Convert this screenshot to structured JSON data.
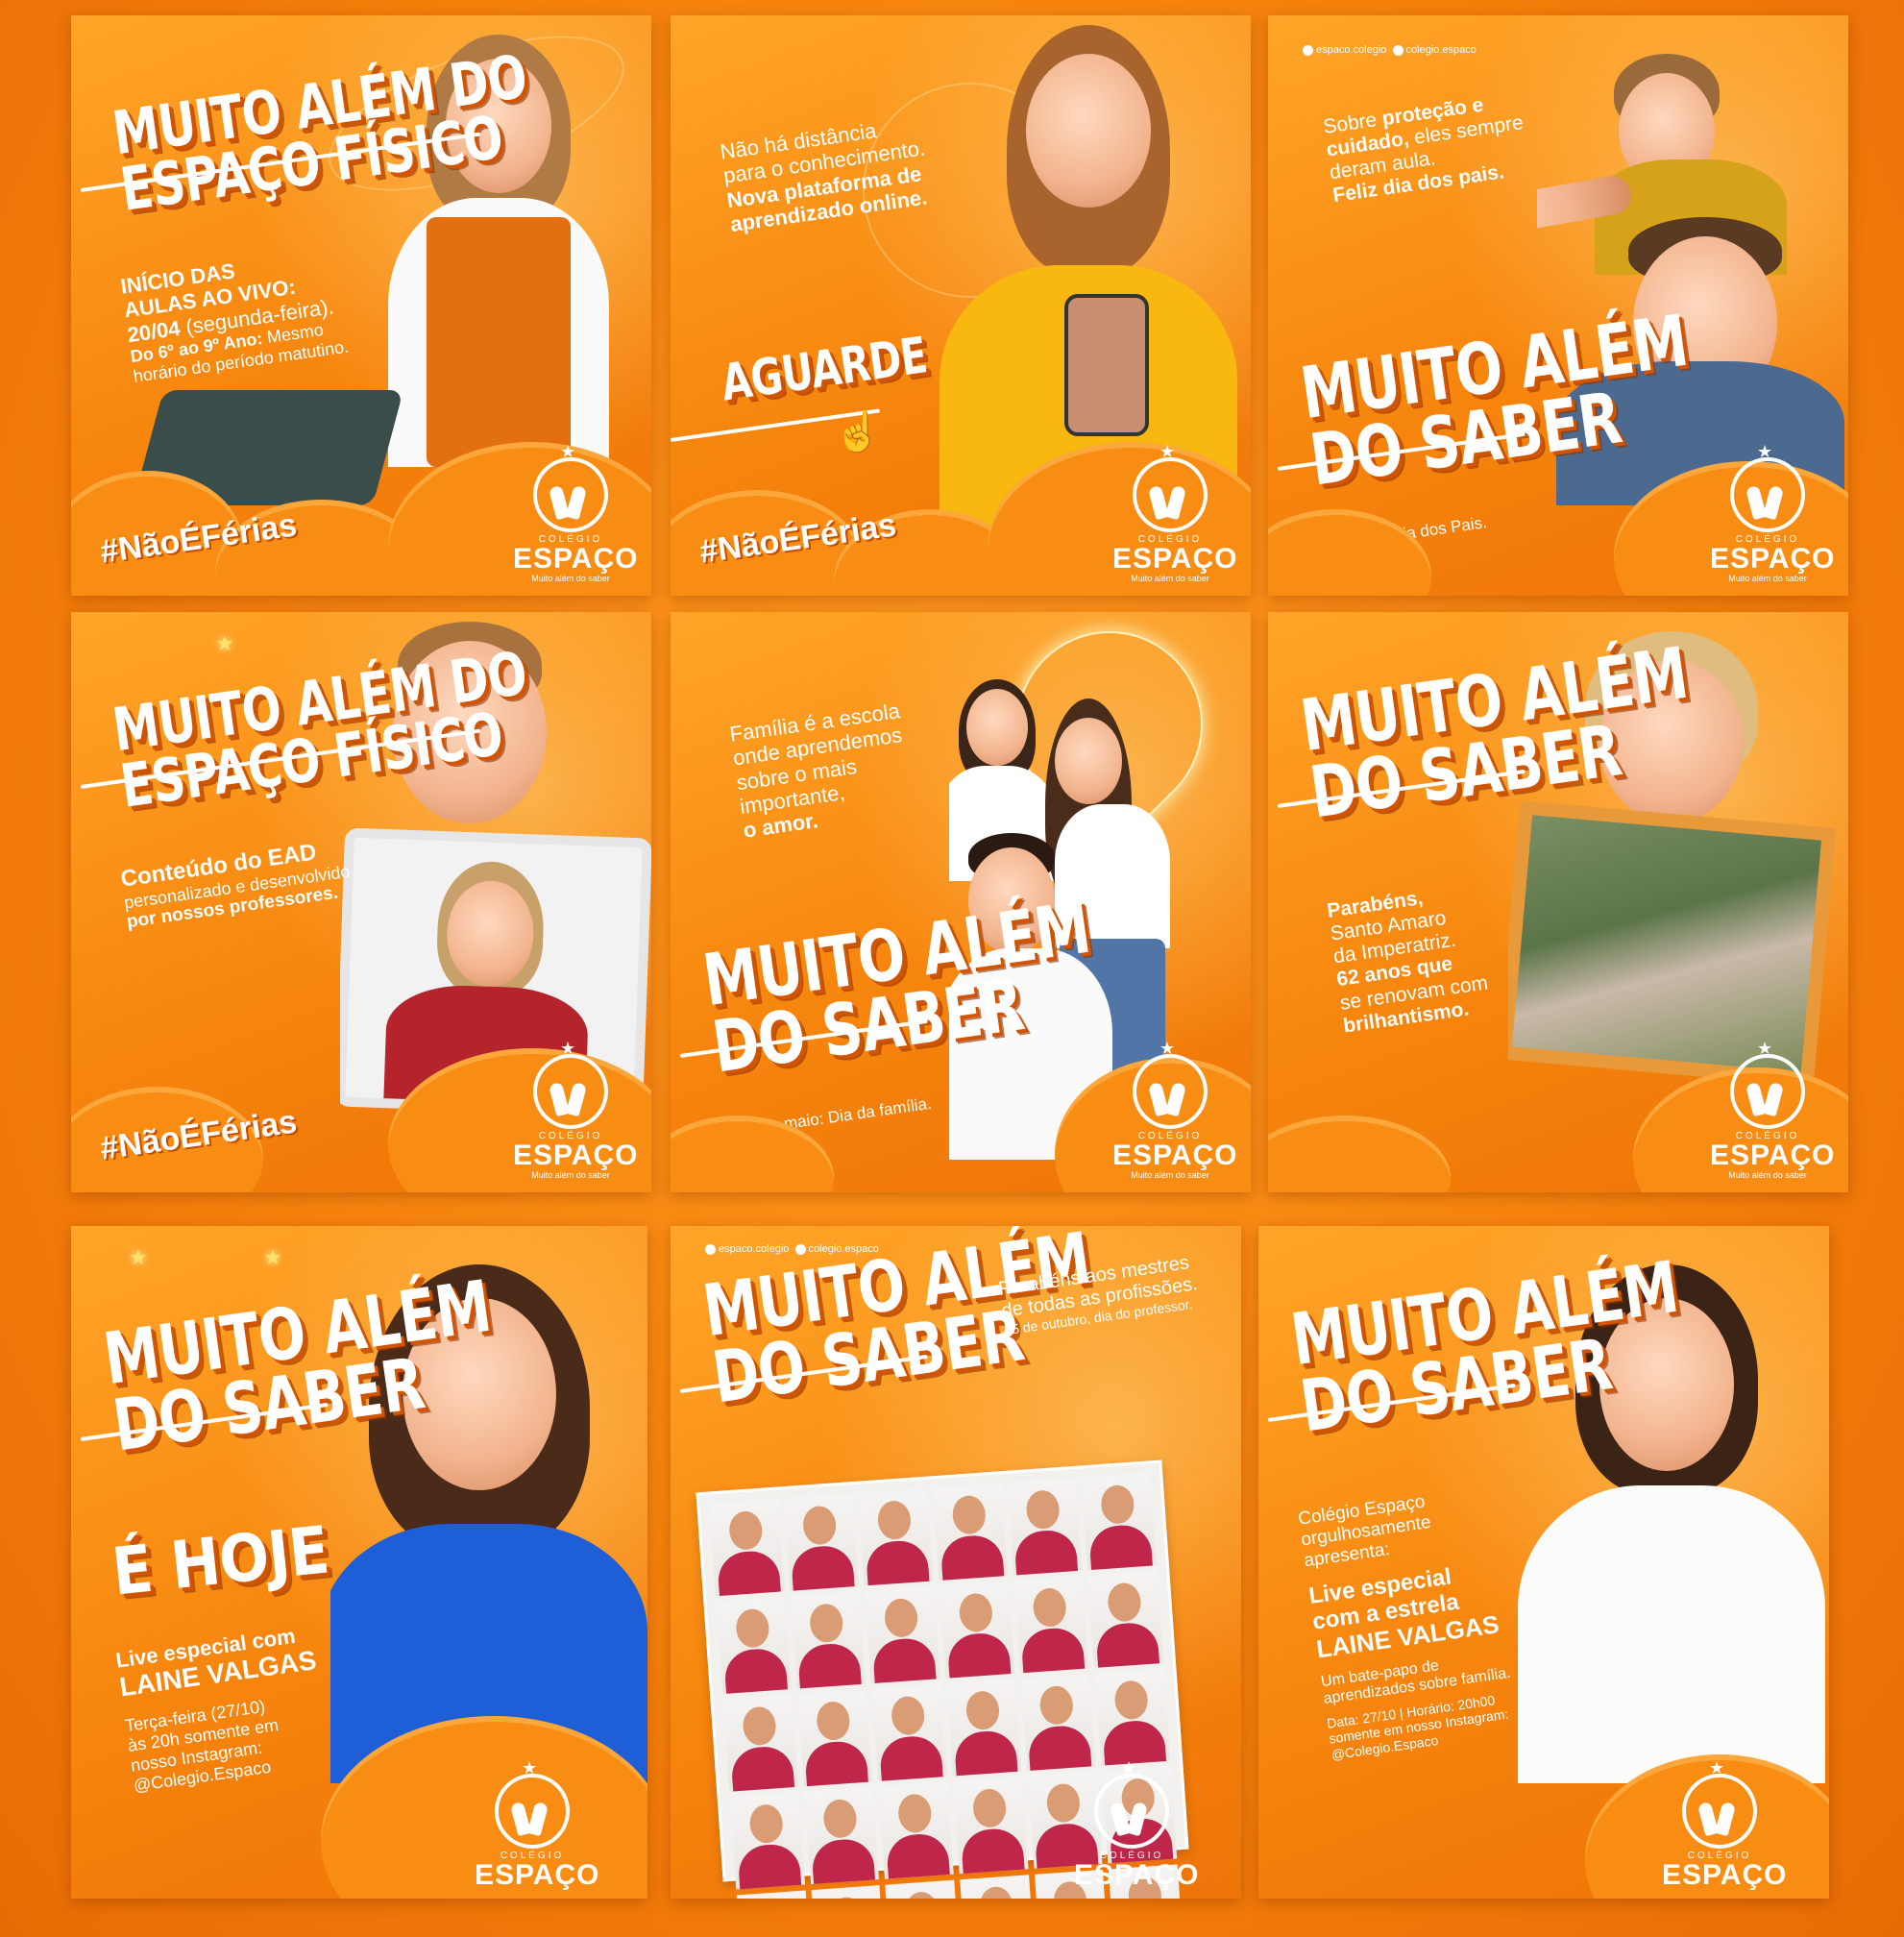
{
  "brand": {
    "small": "COLÉGIO",
    "name": "ESPAÇO",
    "motto": "Muito além do saber",
    "accent": "#f7860e",
    "shirt": "#c0264a"
  },
  "social": {
    "facebook": "espaco.colegio",
    "instagram": "colegio.espaco"
  },
  "posts": {
    "p1": {
      "headline": [
        "MUITO ALÉM DO",
        "ESPAÇO FÍSICO"
      ],
      "body1": "INÍCIO DAS",
      "body2": "AULAS AO VIVO:",
      "date": "20/04",
      "date_note": "(segunda-feira).",
      "grade": "Do 6º ao 9º Ano:",
      "grade_note": "Mesmo",
      "schedule": "horário do período matutino.",
      "tag": "#NãoÉFérias"
    },
    "p2": {
      "line1": "Não há distância",
      "line2": "para o conhecimento.",
      "line3": "Nova plataforma de",
      "line4": "aprendizado online.",
      "cta": "AGUARDE",
      "tag": "#NãoÉFérias"
    },
    "p3": {
      "line1a": "Sobre ",
      "line1b": "proteção e",
      "line2a": "cuidado,",
      "line2b": " eles sempre",
      "line3": "deram aula.",
      "line4": "Feliz dia dos pais.",
      "headline": [
        "MUITO ALÉM",
        "DO SABER"
      ],
      "caption": "09/08 - Dia dos Pais."
    },
    "p4": {
      "headline": [
        "MUITO ALÉM DO",
        "ESPAÇO FÍSICO"
      ],
      "line1": "Conteúdo do EAD",
      "line2": "personalizado e desenvolvido",
      "line3": "por nossos professores.",
      "tag": "#NãoÉFérias"
    },
    "p5": {
      "line1": "Família é a escola",
      "line2": "onde aprendemos",
      "line3": "sobre o mais",
      "line4": "importante,",
      "line5": "o amor.",
      "headline": [
        "MUITO ALÉM",
        "DO SABER"
      ],
      "caption": "15 de maio: Dia da família."
    },
    "p6": {
      "headline": [
        "MUITO ALÉM",
        "DO SABER"
      ],
      "line1": "Parabéns,",
      "line2": "Santo Amaro",
      "line3": "da Imperatriz.",
      "line4": "62 anos que",
      "line5": "se renovam com",
      "line6": "brilhantismo."
    },
    "p7": {
      "headline": [
        "MUITO ALÉM",
        "DO SABER"
      ],
      "big": "É HOJE",
      "line1": "Live especial com",
      "line2": "LAINE VALGAS",
      "line3": "Terça-feira (27/10)",
      "line4": "às 20h somente em",
      "line5": "nosso Instagram:",
      "line6": "@Colegio.Espaco"
    },
    "p8": {
      "headline": [
        "MUITO ALÉM",
        "DO SABER"
      ],
      "line1": "Parabéns aos mestres",
      "line2": "de todas as profissões.",
      "line3": "15 de outubro, dia do professor.",
      "teacher_count": 30
    },
    "p9": {
      "headline": [
        "MUITO ALÉM",
        "DO SABER"
      ],
      "line1": "Colégio Espaço",
      "line2": "orgulhosamente",
      "line3": "apresenta:",
      "line4": "Live especial",
      "line5": "com a estrela",
      "line6": "LAINE VALGAS",
      "line7": "Um bate-papo de",
      "line8": "aprendizados sobre família.",
      "line9": "Data: 27/10 | Horário: 20h00",
      "line10": "somente em nosso Instagram:",
      "line11": "@Colegio.Espaco"
    }
  }
}
